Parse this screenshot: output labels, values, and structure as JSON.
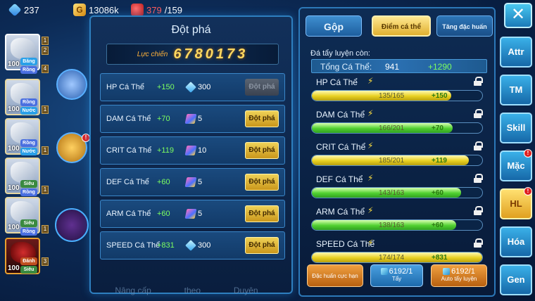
{
  "resources": {
    "gems": "237",
    "gold": "13086k",
    "stamina_current": "379",
    "stamina_max": "/159"
  },
  "roster": [
    {
      "level": "100",
      "tags": [
        "Băng",
        "Rồng"
      ],
      "badges": [
        "1",
        "2",
        "4"
      ]
    },
    {
      "level": "100",
      "tags": [
        "Rồng",
        "Nước"
      ],
      "badges": [
        "1"
      ]
    },
    {
      "level": "100",
      "tags": [
        "Rồng",
        "Nước"
      ],
      "badges": [
        "1"
      ]
    },
    {
      "level": "100",
      "tags": [
        "Siêu",
        "Rồng"
      ],
      "badges": [
        "1"
      ]
    },
    {
      "level": "100",
      "tags": [
        "Siêu",
        "Rồng"
      ],
      "badges": [
        "1"
      ]
    },
    {
      "level": "100",
      "tags": [
        "Đánh",
        "Siêu"
      ],
      "badges": [
        "3"
      ]
    }
  ],
  "breakthrough_panel": {
    "title": "Đột phá",
    "power_label": "Lực chiến",
    "power_value": "6780173",
    "rows": [
      {
        "stat": "HP Cá Thể",
        "increase": "+150",
        "cost_icon": "gem-icon",
        "cost": "300",
        "button": "Đột phá",
        "enabled": false
      },
      {
        "stat": "DAM Cá Thể",
        "increase": "+70",
        "cost_icon": "book-icon",
        "cost": "5",
        "button": "Đột phá",
        "enabled": true
      },
      {
        "stat": "CRIT Cá Thể",
        "increase": "+119",
        "cost_icon": "book-icon",
        "cost": "10",
        "button": "Đột phá",
        "enabled": true
      },
      {
        "stat": "DEF Cá Thể",
        "increase": "+60",
        "cost_icon": "book-icon",
        "cost": "5",
        "button": "Đột phá",
        "enabled": true
      },
      {
        "stat": "ARM Cá Thể",
        "increase": "+60",
        "cost_icon": "book-icon",
        "cost": "5",
        "button": "Đột phá",
        "enabled": true
      },
      {
        "stat": "SPEED Cá Thể",
        "increase": "+831",
        "cost_icon": "gem-icon",
        "cost": "300",
        "button": "Đột phá",
        "enabled": true
      }
    ],
    "bottom_tabs": [
      "Nâng cấp",
      "theo",
      "Duyên"
    ]
  },
  "stat_panel": {
    "tabs": {
      "merge": "Gộp",
      "stat": "Điểm cá thể",
      "special": "Tăng đặc huấn"
    },
    "remaining_label": "Đá tẩy luyện còn:",
    "total": {
      "label": "Tổng Cá Thể:",
      "value": "941",
      "increase": "+1290"
    },
    "stats": [
      {
        "name": "HP Cá Thể",
        "current": 135,
        "max": 165,
        "ratio": "135/165",
        "increase": "+150",
        "color": "yellow"
      },
      {
        "name": "DAM Cá Thể",
        "current": 166,
        "max": 201,
        "ratio": "166/201",
        "increase": "+70",
        "color": "green"
      },
      {
        "name": "CRIT Cá Thể",
        "current": 185,
        "max": 201,
        "ratio": "185/201",
        "increase": "+119",
        "color": "yellow"
      },
      {
        "name": "DEF Cá Thể",
        "current": 143,
        "max": 163,
        "ratio": "143/163",
        "increase": "+60",
        "color": "green"
      },
      {
        "name": "ARM Cá Thể",
        "current": 138,
        "max": 163,
        "ratio": "138/163",
        "increase": "+60",
        "color": "green"
      },
      {
        "name": "SPEED Cá Thể",
        "current": 174,
        "max": 174,
        "ratio": "174/174",
        "increase": "+831",
        "color": "yellow"
      }
    ],
    "actions": {
      "intensive": "Đặc huấn cực hạn",
      "wash_count": "6192/1",
      "wash_label": "Tẩy",
      "auto_count": "6192/1",
      "auto_label": "Auto tẩy luyện"
    }
  },
  "nav": {
    "close": "✕",
    "items": [
      {
        "label": "Attr",
        "alert": false,
        "active": false
      },
      {
        "label": "TM",
        "alert": false,
        "active": false
      },
      {
        "label": "Skill",
        "alert": false,
        "active": false
      },
      {
        "label": "Mặc",
        "alert": true,
        "active": false
      },
      {
        "label": "HL",
        "alert": true,
        "active": true
      },
      {
        "label": "Hóa",
        "alert": false,
        "active": false
      },
      {
        "label": "Gen",
        "alert": false,
        "active": false
      }
    ]
  },
  "colors": {
    "accent": "#2e7fbf",
    "gold": "#e0b030",
    "increase": "#7cff60",
    "alert": "#e02020"
  }
}
